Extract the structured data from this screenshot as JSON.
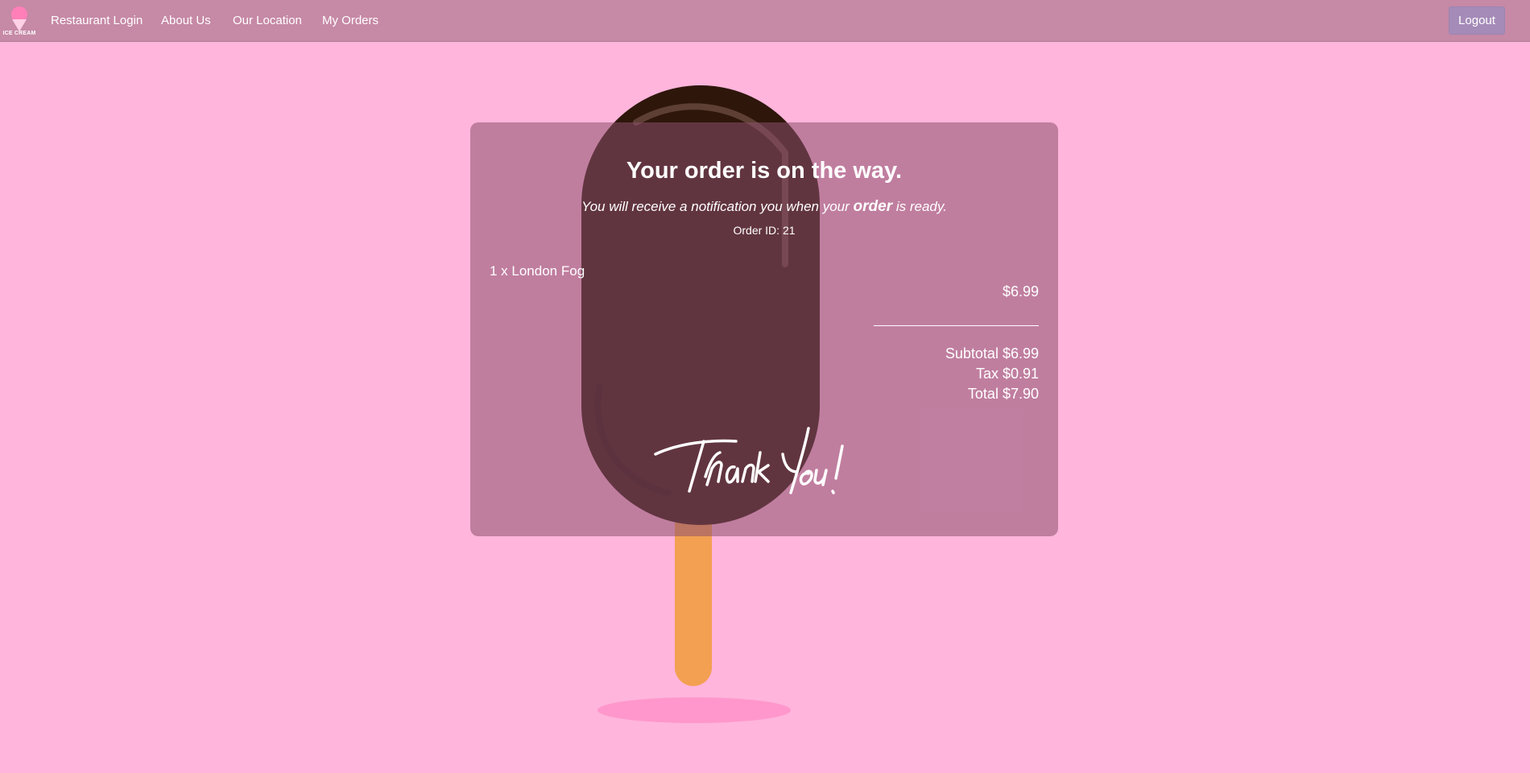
{
  "nav": {
    "brand": "ICE CREAM",
    "links": [
      "Restaurant Login",
      "About Us",
      "Our Location",
      "My Orders"
    ],
    "logout": "Logout"
  },
  "order": {
    "title": "Your order is on the way.",
    "subtitle_part1": "You will receive a notification you when your ",
    "subtitle_emph": "order",
    "subtitle_part2": " is ready.",
    "order_id": "Order ID: 21",
    "items": [
      {
        "label": "1 x London Fog",
        "price": "$6.99"
      }
    ],
    "subtotal": "Subtotal $6.99",
    "tax": "Tax $0.91",
    "total": "Total $7.90",
    "signature": "Thank You!"
  },
  "colors": {
    "background": "#ffb5dc",
    "navbar": "#c689a6",
    "card": "rgba(140,80,110,0.55)",
    "chocolate": "#2e160b",
    "stick": "#f3a052"
  }
}
